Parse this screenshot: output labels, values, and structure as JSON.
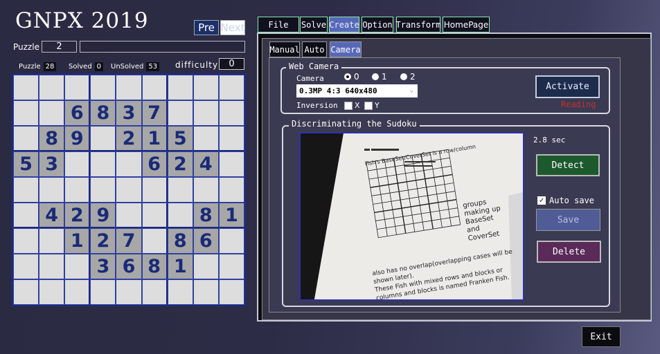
{
  "app": {
    "title": "GNPX 2019"
  },
  "nav": {
    "pre_label": "Pre",
    "next_label": "Next"
  },
  "puzzle": {
    "label": "Puzzle",
    "number": "2",
    "name": ""
  },
  "stats": {
    "puzzle_label": "Puzzle",
    "puzzle_value": "28",
    "solved_label": "Solved",
    "solved_value": "0",
    "unsolved_label": "UnSolved",
    "unsolved_value": "53",
    "difficulty_label": "difficulty",
    "difficulty_value": "0"
  },
  "grid": [
    [
      "",
      "",
      "",
      "",
      "",
      "",
      "",
      "",
      ""
    ],
    [
      "",
      "",
      "6",
      "8",
      "3",
      "7",
      "",
      "",
      ""
    ],
    [
      "",
      "8",
      "9",
      "",
      "2",
      "1",
      "5",
      "",
      ""
    ],
    [
      "5",
      "3",
      "",
      "",
      "",
      "6",
      "2",
      "4",
      ""
    ],
    [
      "",
      "",
      "",
      "",
      "",
      "",
      "",
      "",
      ""
    ],
    [
      "",
      "4",
      "2",
      "9",
      "",
      "",
      "",
      "8",
      "1"
    ],
    [
      "",
      "",
      "1",
      "2",
      "7",
      "",
      "8",
      "6",
      ""
    ],
    [
      "",
      "",
      "",
      "3",
      "6",
      "8",
      "1",
      "",
      ""
    ],
    [
      "",
      "",
      "",
      "",
      "",
      "",
      "",
      "",
      ""
    ]
  ],
  "tabs": [
    "File",
    "Solve",
    "Create",
    "Option",
    "Transform",
    "HomePage"
  ],
  "active_tab": "Create",
  "subtabs": [
    "Manual",
    "Auto",
    "Camera"
  ],
  "active_subtab": "Camera",
  "webcam": {
    "legend": "Web Camera",
    "camera_label": "Camera",
    "camera_options": [
      "0",
      "1",
      "2"
    ],
    "selected_camera": "0",
    "resolution": "0.3MP 4:3 640x480",
    "inversion_label": "Inversion",
    "inversion_x": "X",
    "inversion_y": "Y",
    "activate_label": "Activate",
    "status": "Reading"
  },
  "discriminate": {
    "legend": "Discriminating the Sudoku",
    "time": "2.8 sec",
    "detect_label": "Detect",
    "autosave_label": "Auto save",
    "autosave_checked": true,
    "save_label": "Save",
    "delete_label": "Delete"
  },
  "camera_image": {
    "lines": [
      "Fish's BaseSet/CoverSet is a row/column",
      "also has no overlap(overlapping cases will be",
      "shown later).",
      "These Fish with mixed rows and blocks or",
      "columns and blocks is named Franken Fish."
    ],
    "side_text": [
      "groups",
      "making up",
      "BaseSet",
      "and",
      "CoverSet"
    ]
  },
  "exit_label": "Exit",
  "colors": {
    "accent": "#5868b8",
    "given_cell": "#a7a7a7",
    "digit": "#1a2a78",
    "reading": "#c83030"
  }
}
